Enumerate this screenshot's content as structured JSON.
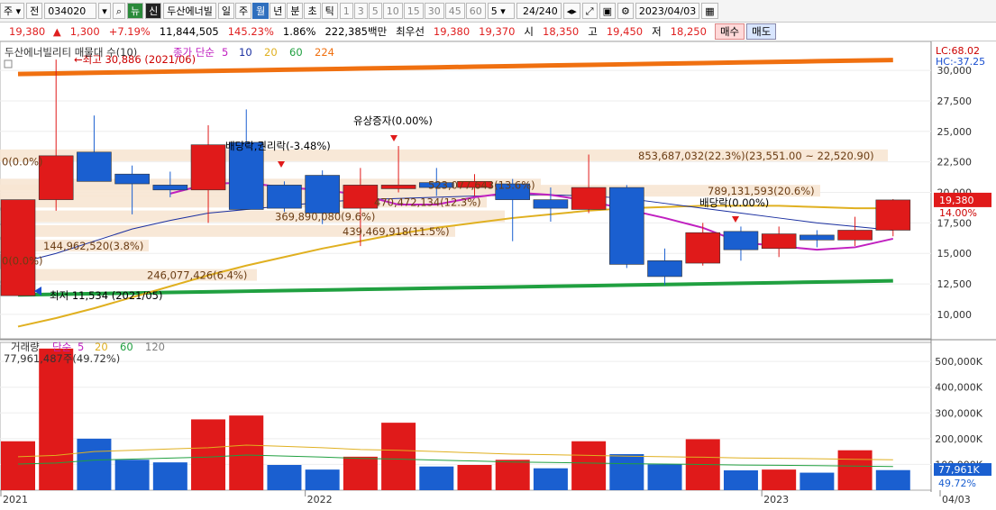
{
  "toolbar": {
    "market": "주",
    "prev_label": "전",
    "code": "034020",
    "search_icon": "search-icon",
    "cancel_label": "뉴",
    "credit_label": "신",
    "name": "두산에너빌",
    "periods": [
      "일",
      "주",
      "월",
      "년",
      "분",
      "초",
      "틱"
    ],
    "selected_period": "월",
    "intervals": [
      "1",
      "3",
      "5",
      "10",
      "15",
      "30",
      "45",
      "60"
    ],
    "count_value": "5",
    "range": "24",
    "range_total": "/240",
    "date": "2023/04/03"
  },
  "ticker": {
    "price": "19,380",
    "change_icon": "up-triangle-icon",
    "change": "1,300",
    "rate": "+7.19%",
    "volume": "11,844,505",
    "volume_rate": "145.23%",
    "turnover": "1.86%",
    "amount": "222,385백만",
    "priority_label": "최우선",
    "ask": "19,380",
    "bid": "19,370",
    "open_label": "시",
    "open": "18,350",
    "high_label": "고",
    "high": "19,450",
    "low_label": "저",
    "low": "18,250",
    "buy_label": "매수",
    "sell_label": "매도"
  },
  "chart_data": [
    {
      "type": "candlestick",
      "title": "두산에너빌리티 매물대 수(10)",
      "legend": "종가 단순 5 10 20 60 224",
      "legend_items": [
        {
          "label": "종가 단순",
          "color": "#c020c0"
        },
        {
          "label": "5",
          "color": "#c020c0"
        },
        {
          "label": "10",
          "color": "#1a2fa0"
        },
        {
          "label": "20",
          "color": "#e0b020"
        },
        {
          "label": "60",
          "color": "#20a040"
        },
        {
          "label": "224",
          "color": "#f07010"
        }
      ],
      "lc": "LC:68.02",
      "hc": "HC:-37.25",
      "ylim": [
        8000,
        32000
      ],
      "yticks": [
        10000,
        12500,
        15000,
        17500,
        20000,
        22500,
        25000,
        27500,
        30000
      ],
      "ytick_labels": [
        "10,000",
        "12,500",
        "15,000",
        "17,500",
        "20,000",
        "22,500",
        "25,000",
        "27,500",
        "30,000"
      ],
      "current_price": "19,380",
      "current_rate": "14.00%",
      "candles": [
        {
          "open": 11534,
          "close": 19400,
          "high": 19400,
          "low": 11534
        },
        {
          "open": 19400,
          "close": 23000,
          "high": 30886,
          "low": 18500
        },
        {
          "open": 23300,
          "close": 20900,
          "high": 26300,
          "low": 20900
        },
        {
          "open": 21500,
          "close": 20700,
          "high": 22200,
          "low": 18200
        },
        {
          "open": 20600,
          "close": 20200,
          "high": 21700,
          "low": 19600
        },
        {
          "open": 20200,
          "close": 23900,
          "high": 25500,
          "low": 17500
        },
        {
          "open": 24100,
          "close": 18600,
          "high": 26800,
          "low": 18600
        },
        {
          "open": 20600,
          "close": 18700,
          "high": 20900,
          "low": 18400
        },
        {
          "open": 21400,
          "close": 18300,
          "high": 21800,
          "low": 17400
        },
        {
          "open": 18700,
          "close": 20600,
          "high": 22000,
          "low": 15600
        },
        {
          "open": 20300,
          "close": 20600,
          "high": 23800,
          "low": 20000
        },
        {
          "open": 20800,
          "close": 20400,
          "high": 22000,
          "low": 19700
        },
        {
          "open": 20400,
          "close": 20900,
          "high": 21500,
          "low": 19700
        },
        {
          "open": 20700,
          "close": 19400,
          "high": 21100,
          "low": 16000
        },
        {
          "open": 19400,
          "close": 18700,
          "high": 20400,
          "low": 17600
        },
        {
          "open": 18600,
          "close": 20400,
          "high": 23100,
          "low": 18300
        },
        {
          "open": 20400,
          "close": 14100,
          "high": 20600,
          "low": 13800
        },
        {
          "open": 14400,
          "close": 13100,
          "high": 15400,
          "low": 12400
        },
        {
          "open": 14200,
          "close": 16700,
          "high": 17500,
          "low": 14000
        },
        {
          "open": 16800,
          "close": 15300,
          "high": 17200,
          "low": 14400
        },
        {
          "open": 15400,
          "close": 16600,
          "high": 17200,
          "low": 14700
        },
        {
          "open": 16500,
          "close": 16100,
          "high": 16900,
          "low": 15500
        },
        {
          "open": 16100,
          "close": 16900,
          "high": 18000,
          "low": 15600
        },
        {
          "open": 16900,
          "close": 19380,
          "high": 19450,
          "low": 16400
        }
      ],
      "ma5": [
        null,
        null,
        null,
        null,
        19900,
        20700,
        20800,
        20400,
        20200,
        19800,
        19000,
        19000,
        19600,
        20000,
        19800,
        19300,
        18600,
        17900,
        17100,
        15900,
        15600,
        15300,
        15500,
        16200
      ],
      "ma10": [
        14200,
        15000,
        16000,
        17000,
        17700,
        18300,
        18600,
        18900,
        19200,
        19400,
        19500,
        19600,
        19700,
        19800,
        19800,
        19700,
        19500,
        19100,
        18700,
        18300,
        17900,
        17500,
        17200,
        16900
      ],
      "ma20": [
        9000,
        9700,
        10500,
        11400,
        12300,
        13200,
        14000,
        14700,
        15400,
        16000,
        16600,
        17100,
        17500,
        17900,
        18200,
        18500,
        18700,
        18800,
        18900,
        18900,
        18900,
        18800,
        18700,
        18700
      ],
      "ma60": [
        11600,
        11650,
        11700,
        11750,
        11800,
        11850,
        11900,
        11950,
        12000,
        12050,
        12100,
        12150,
        12200,
        12250,
        12300,
        12350,
        12400,
        12450,
        12500,
        12550,
        12600,
        12650,
        12700,
        12750
      ],
      "ma224": [
        29700,
        29750,
        29800,
        29850,
        29900,
        29950,
        30000,
        30050,
        30100,
        30150,
        30200,
        30250,
        30300,
        30350,
        30400,
        30450,
        30500,
        30550,
        30600,
        30650,
        30700,
        30750,
        30800,
        30850
      ],
      "volume_profile": [
        {
          "label": "0(0.0%)",
          "price": 22500
        },
        {
          "label": "",
          "price": 21200
        },
        {
          "label": "853,687,032(22.3%)(23,551.00 ~ 22,520.90)",
          "price": 23000
        },
        {
          "label": "523,077,643(13.6%)",
          "price": 20600
        },
        {
          "label": "789,131,593(20.6%)",
          "price": 20100
        },
        {
          "label": "470,472,134(12.3%)",
          "price": 19200
        },
        {
          "label": "369,890,080(9.6%)",
          "price": 18000
        },
        {
          "label": "439,469,918(11.5%)",
          "price": 16800
        },
        {
          "label": "144,962,520(3.8%)",
          "price": 15600
        },
        {
          "label": "0(0.0%)",
          "price": 14400
        },
        {
          "label": "246,077,426(6.4%)",
          "price": 13200
        }
      ],
      "annotations": [
        {
          "text": "←최고 30,886 (2021/06)",
          "price": 30886
        },
        {
          "text": "배당락,권리락(-3.48%)",
          "price": 22400
        },
        {
          "text": "유상증자(0.00%)",
          "price": 25500
        },
        {
          "text": "배당락(0.00%)",
          "price": 19500
        },
        {
          "text": "최저 11,534 (2021/05)",
          "price": 11534
        }
      ]
    },
    {
      "type": "bar",
      "title": "거래량",
      "legend_items": [
        {
          "label": "단순",
          "color": "#c020c0"
        },
        {
          "label": "5",
          "color": "#c020c0"
        },
        {
          "label": "20",
          "color": "#e0b020"
        },
        {
          "label": "60",
          "color": "#20a040"
        },
        {
          "label": "120",
          "color": "#808080"
        }
      ],
      "max_label": "77,961,487주(49.72%)",
      "ylim": [
        0,
        560000
      ],
      "yticks": [
        100000,
        200000,
        300000,
        400000,
        500000
      ],
      "ytick_labels": [
        "100,000K",
        "200,000K",
        "300,000K",
        "400,000K",
        "500,000K"
      ],
      "current_volume": "77,961K",
      "current_rate": "49.72%",
      "x_labels": [
        {
          "label": "2021",
          "index": 0
        },
        {
          "label": "2022",
          "index": 8
        },
        {
          "label": "2023",
          "index": 20
        },
        {
          "label": "04/03",
          "index": 24
        }
      ],
      "values": [
        190000,
        550000,
        200000,
        118000,
        108000,
        275000,
        290000,
        98000,
        80000,
        130000,
        262000,
        92000,
        98000,
        118000,
        85000,
        190000,
        140000,
        100000,
        198000,
        77000,
        80000,
        68000,
        155000,
        78000
      ],
      "colors": [
        "red",
        "red",
        "blue",
        "blue",
        "blue",
        "red",
        "red",
        "blue",
        "blue",
        "red",
        "red",
        "blue",
        "red",
        "red",
        "blue",
        "red",
        "blue",
        "blue",
        "red",
        "blue",
        "red",
        "blue",
        "red",
        "blue"
      ],
      "ma_values": [
        130000,
        135000,
        150000,
        155000,
        160000,
        165000,
        175000,
        170000,
        165000,
        158000,
        155000,
        150000,
        145000,
        140000,
        138000,
        135000,
        132000,
        130000,
        128000,
        125000,
        124000,
        122000,
        120000,
        118000
      ]
    }
  ]
}
